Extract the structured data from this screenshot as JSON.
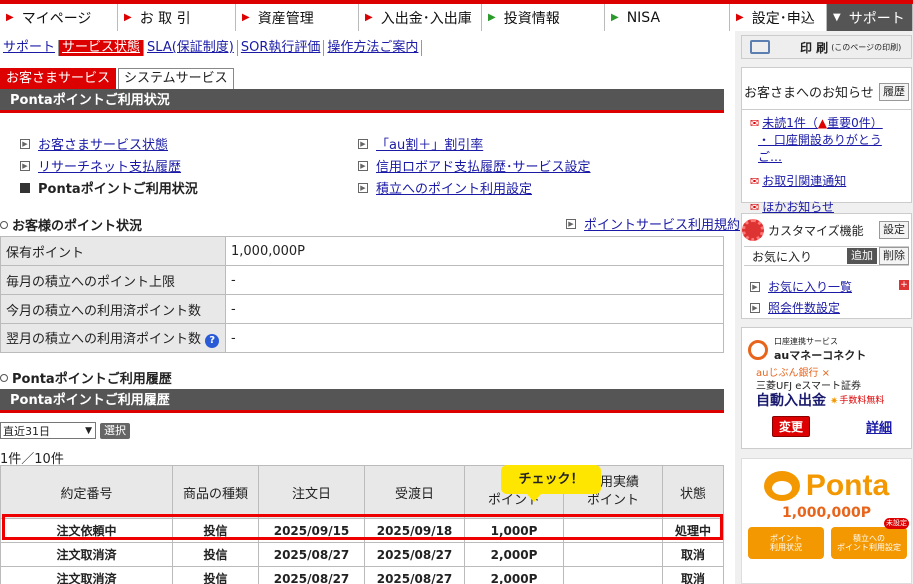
{
  "topnav": [
    {
      "label": "マイページ",
      "w": 118
    },
    {
      "label": "お 取 引",
      "w": 118
    },
    {
      "label": "資産管理",
      "w": 123
    },
    {
      "label": "入出金･入出庫",
      "w": 123
    },
    {
      "label": "投資情報",
      "w": 123
    },
    {
      "label": "NISA",
      "w": 125
    },
    {
      "label": "設定･申込",
      "w": 97
    },
    {
      "label": "サポート",
      "w": 86
    }
  ],
  "subnav": [
    "サポート",
    "サービス状態",
    "SLA(保証制度)",
    "SOR執行評価",
    "操作方法ご案内"
  ],
  "print": {
    "label": "印 刷",
    "sub": "(このページの印刷)"
  },
  "tabs": [
    "お客さまサービス",
    "システムサービス"
  ],
  "section_bar_1": "Pontaポイントご利用状況",
  "menu": {
    "left": [
      "お客さまサービス状態",
      "リサーチネット支払履歴",
      "Pontaポイントご利用状況"
    ],
    "right": [
      "「au割＋」割引率",
      "信用ロボアド支払履歴･サービス設定",
      "積立へのポイント利用設定"
    ]
  },
  "status_head": "お客様のポイント状況",
  "terms_link": "ポイントサービス利用規約",
  "status_rows": [
    {
      "label": "保有ポイント",
      "value": "1,000,000P"
    },
    {
      "label": "毎月の積立へのポイント上限",
      "value": "-"
    },
    {
      "label": "今月の積立への利用済ポイント数",
      "value": "-"
    },
    {
      "label": "翌月の積立への利用済ポイント数",
      "value": "-"
    }
  ],
  "history_head": "Pontaポイントご利用履歴",
  "section_bar_2": "Pontaポイントご利用履歴",
  "period": {
    "selected": "直近31日",
    "button": "選択"
  },
  "count": "1件／10件",
  "table": {
    "headers": [
      "約定番号",
      "商品の種類",
      "注文日",
      "受渡日",
      "利用\nポイント",
      "利用実績\nポイント",
      "状態"
    ],
    "rows": [
      [
        "注文依頼中",
        "投信",
        "2025/09/15",
        "2025/09/18",
        "1,000P",
        "",
        "処理中"
      ],
      [
        "注文取消済",
        "投信",
        "2025/08/27",
        "2025/08/27",
        "2,000P",
        "",
        "取消"
      ],
      [
        "注文取消済",
        "投信",
        "2025/08/27",
        "2025/08/27",
        "2,000P",
        "",
        "取消"
      ]
    ]
  },
  "callout": "チェック！",
  "notice": {
    "title": "お客さまへのお知らせ",
    "history_btn": "履歴",
    "unread": "未読1件（",
    "important": "重要0件）",
    "item": "・ 口座開設ありがとうご…",
    "trade": "お取引関連通知",
    "other": "ほかお知らせ"
  },
  "customize": {
    "title": "カスタマイズ機能",
    "btn": "設定",
    "fav": "お気に入り",
    "add": "追加",
    "del": "削除",
    "fav_list": "お気に入り一覧",
    "count_setting": "照会件数設定"
  },
  "au": {
    "small": "口座連携サービス",
    "brand": "auマネーコネクト",
    "bank": "auじぶん銀行 ×",
    "sec": "三菱UFJ eスマート証券",
    "auto": "自動入出金",
    "fee": "手数料無料",
    "change": "変更",
    "detail": "詳細"
  },
  "ponta": {
    "logo": "Ponta",
    "points": "1,000,000P",
    "btn1a": "ポイント",
    "btn1b": "利用状況",
    "btn2a": "積立への",
    "btn2b": "ポイント利用設定",
    "badge": "未設定"
  }
}
